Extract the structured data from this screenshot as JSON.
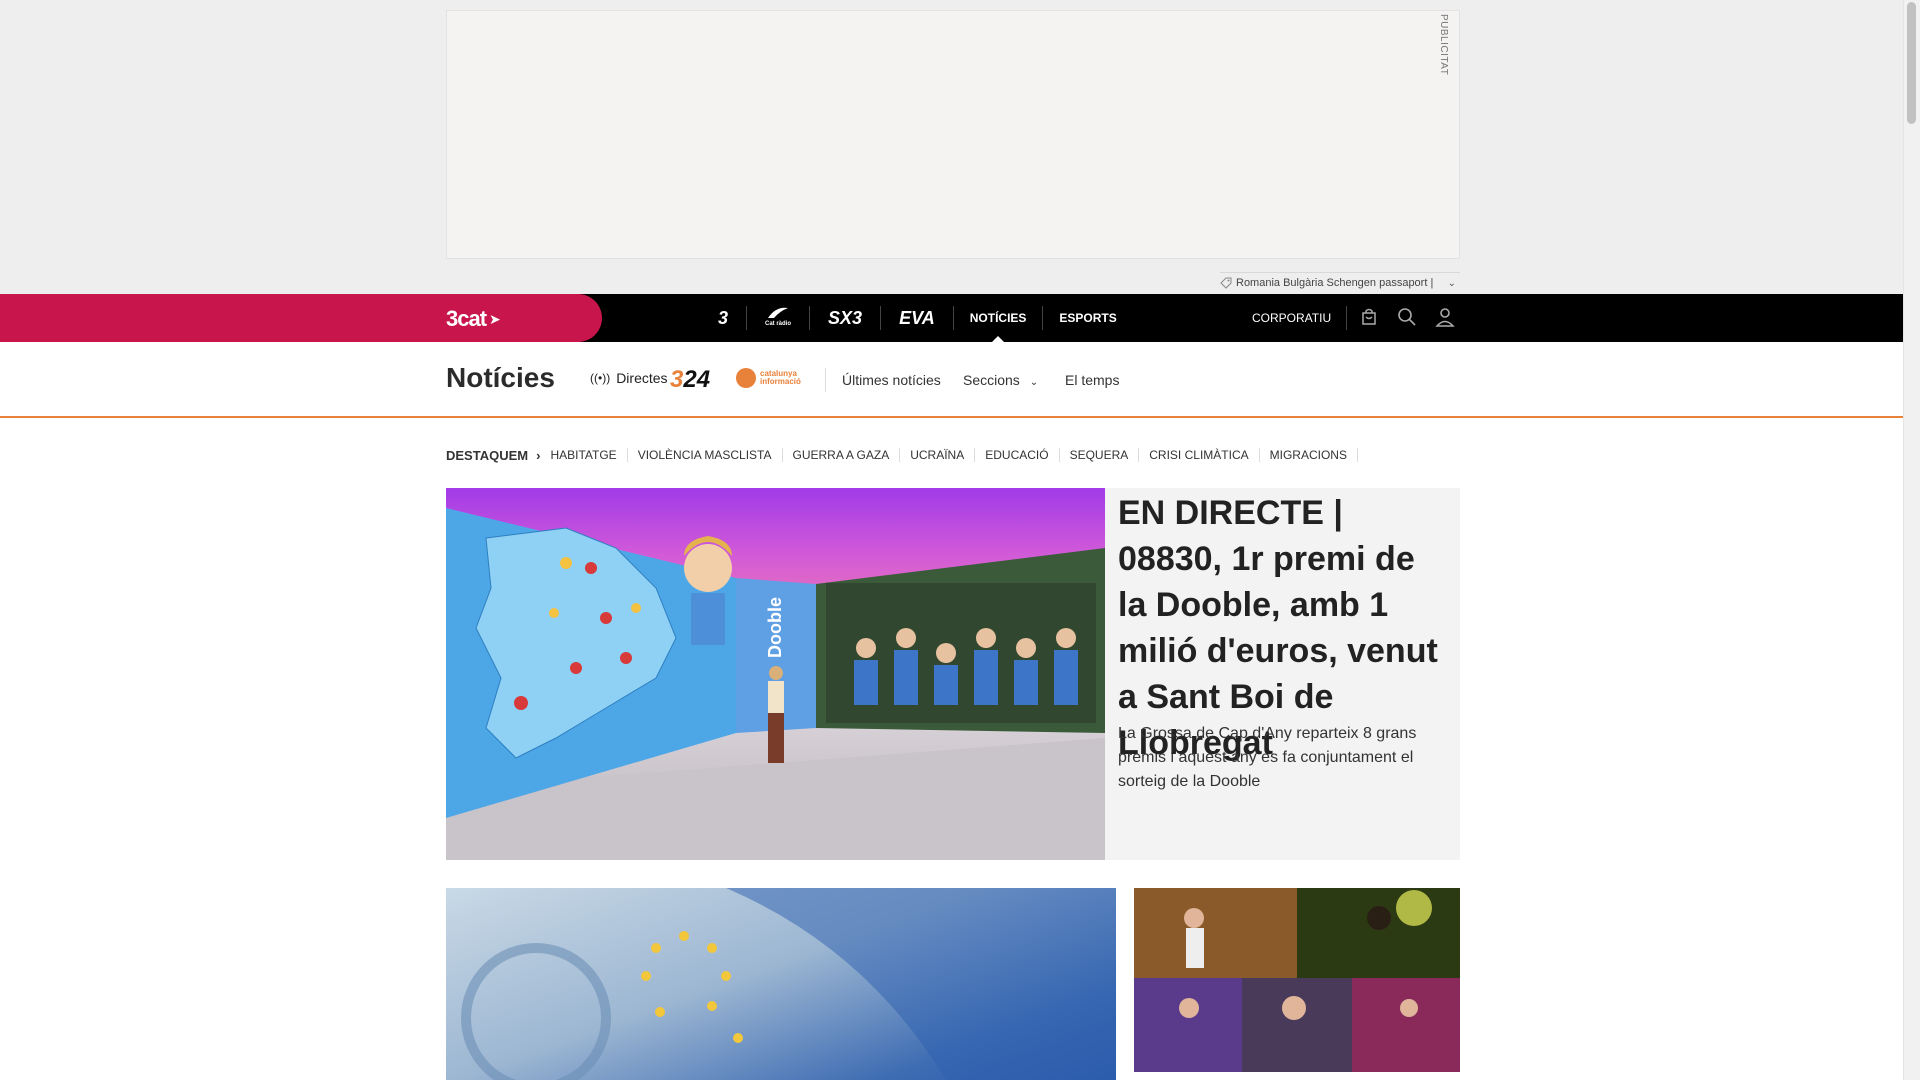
{
  "ad": {
    "label": "PUBLICITAT"
  },
  "tag_strip": {
    "text": "Romania Bulgària Schengen passaport |"
  },
  "topbar": {
    "brand": "3cat",
    "channels": [
      "3",
      "Cat ràdio",
      "SX3",
      "EVA"
    ],
    "nav": [
      "NOTÍCIES",
      "ESPORTS"
    ],
    "active_nav": "NOTÍCIES",
    "corporate": "CORPORATIU",
    "icons": [
      "shopping-bag-icon",
      "search-icon",
      "user-icon"
    ]
  },
  "section": {
    "title": "Notícies",
    "live_label": "Directes",
    "logo_324": "324",
    "logo_catinfo": "catalunya informació",
    "links": {
      "latest": "Últimes notícies",
      "sections": "Seccions",
      "weather": "El temps"
    }
  },
  "topics": {
    "featured_label": "DESTAQUEM",
    "items": [
      "HABITATGE",
      "VIOLÈNCIA MASCLISTA",
      "GUERRA A GAZA",
      "UCRAÏNA",
      "EDUCACIÓ",
      "SEQUERA",
      "CRISI CLIMÀTICA",
      "MIGRACIONS"
    ]
  },
  "lead_story": {
    "headline": "EN DIRECTE | 08830, 1r premi de la Dooble, amb 1 milió d'euros, venut a Sant Boi de Llobregat",
    "summary": "La Grossa de Cap d'Any reparteix 8 grans premis i aquest any es fa conjuntament el sorteig de la Dooble",
    "image_text": "Dooble"
  },
  "colors": {
    "brand_pink": "#c8154c",
    "accent_orange": "#e8813a",
    "topbar_black": "#000000"
  }
}
